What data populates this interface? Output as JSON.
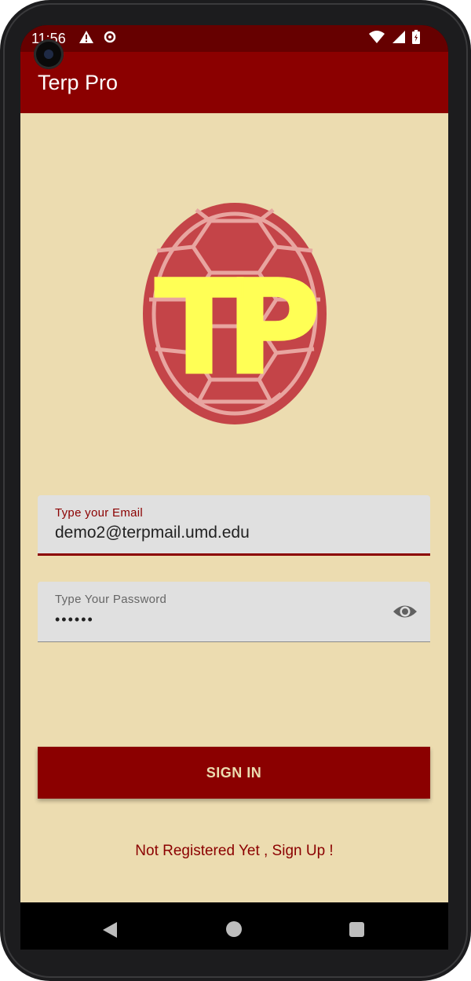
{
  "status_bar": {
    "time": "11:56",
    "left_icons": [
      "warning-icon",
      "sync-icon"
    ],
    "right_icons": [
      "wifi-icon",
      "signal-icon",
      "battery-icon"
    ]
  },
  "app_bar": {
    "title": "Terp Pro"
  },
  "logo": {
    "text": "TP"
  },
  "email_field": {
    "label": "Type your Email",
    "value": "demo2@terpmail.umd.edu"
  },
  "password_field": {
    "label": "Type Your Password",
    "value": "••••••",
    "toggle_icon": "eye-icon"
  },
  "sign_in_button": {
    "label": "SIGN IN"
  },
  "signup_link": {
    "label": "Not Registered Yet , Sign Up !"
  },
  "nav_bar": {
    "buttons": [
      "back-icon",
      "home-icon",
      "recents-icon"
    ]
  },
  "colors": {
    "primary": "#8b0000",
    "status_bar": "#660000",
    "background": "#ecdcb0",
    "field_background": "#e0e0e0"
  }
}
